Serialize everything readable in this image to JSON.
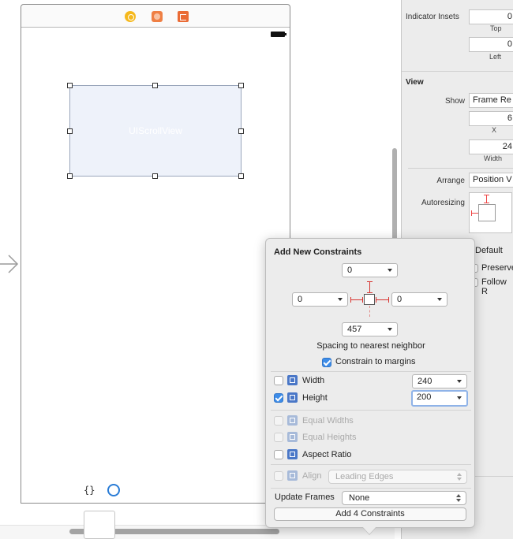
{
  "scene": {
    "scroll_view_label": "UIScrollView"
  },
  "inspector": {
    "scroll_view": {
      "indicator_insets_label": "Indicator Insets",
      "top_value": "0",
      "top_caption": "Top",
      "left_value": "0",
      "left_caption": "Left"
    },
    "view": {
      "section_title": "View",
      "show_label": "Show",
      "show_value": "Frame Re",
      "x_value": "6",
      "x_caption": "X",
      "width_value": "24",
      "width_caption": "Width",
      "arrange_label": "Arrange",
      "arrange_value": "Position V",
      "autoresizing_label": "Autoresizing",
      "layout_value": "Default",
      "preserve_label": "Preserve",
      "follow_label": "Follow R"
    },
    "library_braces": "{}"
  },
  "popover": {
    "title": "Add New Constraints",
    "top_spacing": "0",
    "left_spacing": "0",
    "right_spacing": "0",
    "bottom_spacing": "457",
    "spacing_caption": "Spacing to nearest neighbor",
    "constrain_margins_label": "Constrain to margins",
    "constrain_margins_checked": true,
    "width_label": "Width",
    "width_value": "240",
    "width_checked": false,
    "height_label": "Height",
    "height_value": "200",
    "height_checked": true,
    "equal_widths_label": "Equal Widths",
    "equal_heights_label": "Equal Heights",
    "aspect_ratio_label": "Aspect Ratio",
    "align_label": "Align",
    "align_value": "Leading Edges",
    "update_frames_label": "Update Frames",
    "update_frames_value": "None",
    "add_button_label": "Add 4 Constraints"
  },
  "colors": {
    "accent": "#3d8ce8",
    "constraint_red": "#d8322e",
    "scroll_view_fill": "#eef2fa"
  }
}
